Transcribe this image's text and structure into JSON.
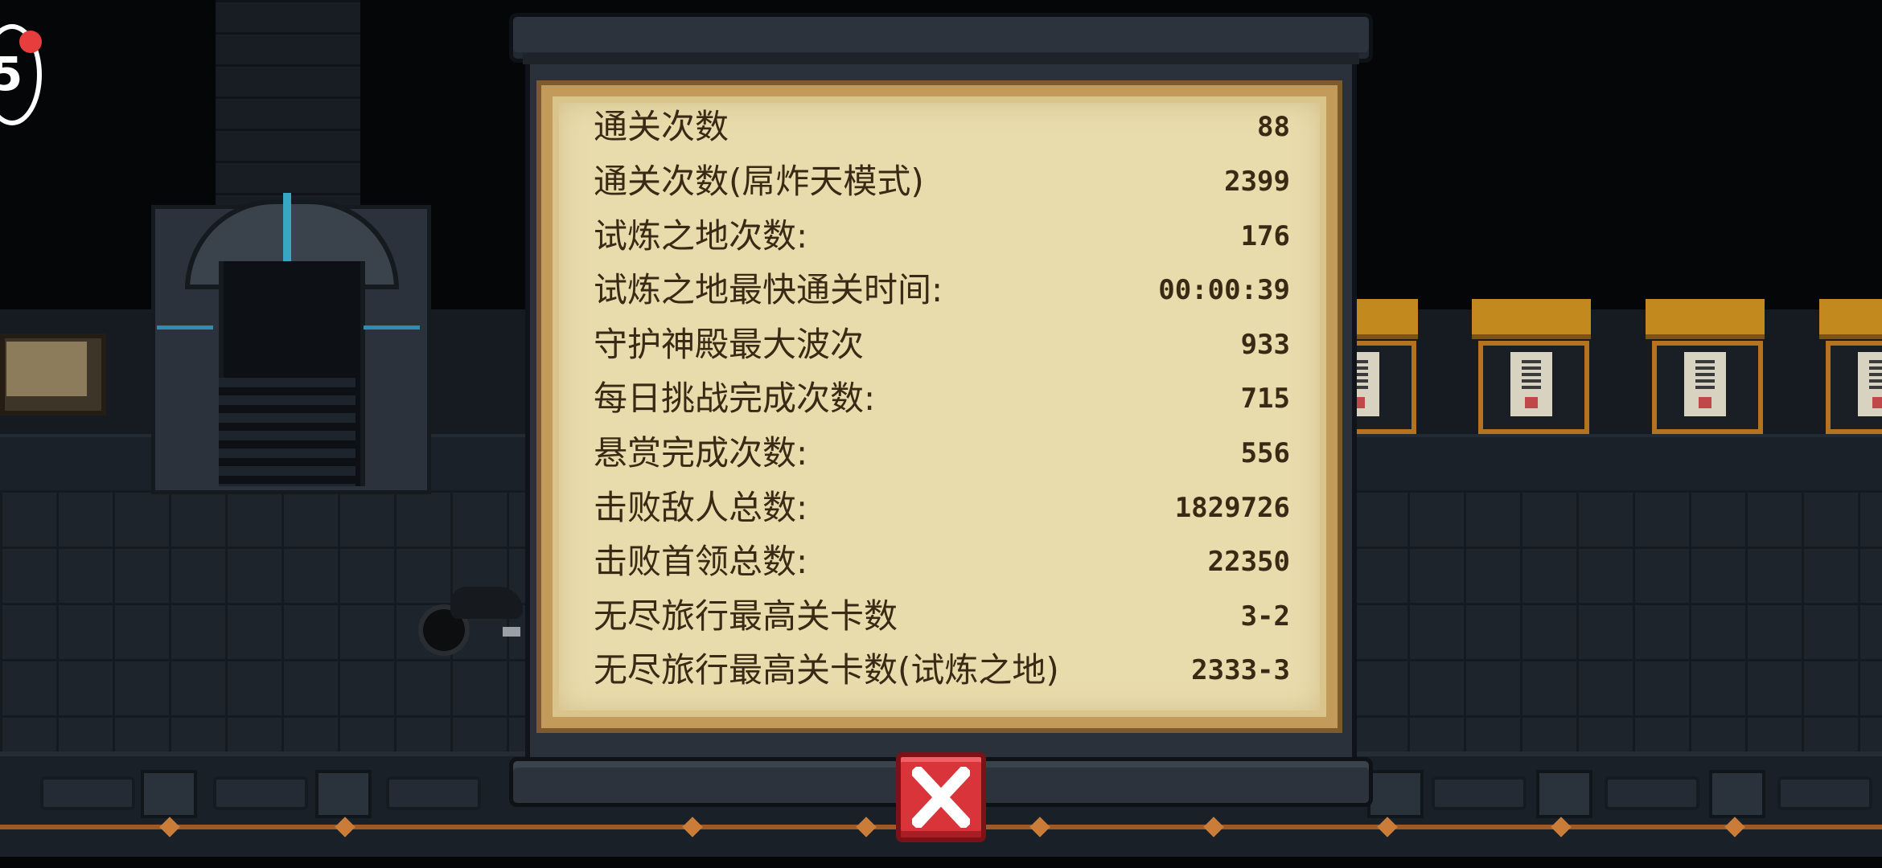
{
  "level_badge": {
    "level": "5",
    "has_notification": true
  },
  "stats_panel": {
    "rows": [
      {
        "label": "通关次数",
        "value": "88"
      },
      {
        "label": "通关次数(屌炸天模式)",
        "value": "2399"
      },
      {
        "label": "试炼之地次数:",
        "value": "176"
      },
      {
        "label": "试炼之地最快通关时间:",
        "value": "00:00:39"
      },
      {
        "label": "守护神殿最大波次",
        "value": "933"
      },
      {
        "label": "每日挑战完成次数:",
        "value": "715"
      },
      {
        "label": "悬赏完成次数:",
        "value": "556"
      },
      {
        "label": "击败敌人总数:",
        "value": "1829726"
      },
      {
        "label": "击败首领总数:",
        "value": "22350"
      },
      {
        "label": "无尽旅行最高关卡数",
        "value": "3-2"
      },
      {
        "label": "无尽旅行最高关卡数(试炼之地)",
        "value": "2333-3"
      }
    ]
  },
  "close_button": {
    "icon": "close-icon",
    "color": "#d8343a"
  },
  "colors": {
    "parchment": "#e9dcac",
    "text": "#3a2a15",
    "rod": "#2c333c"
  }
}
